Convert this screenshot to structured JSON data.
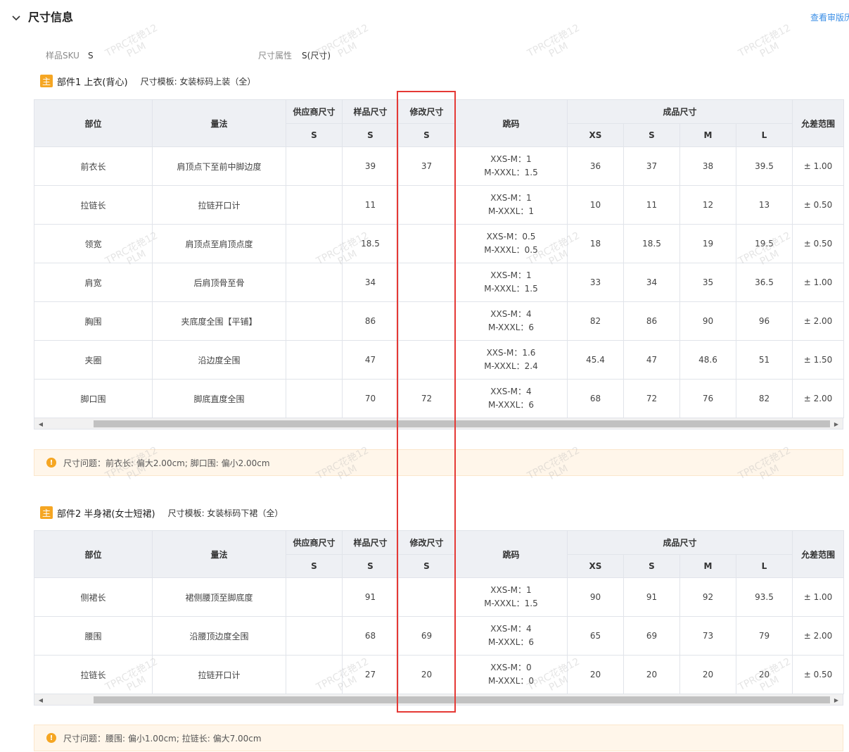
{
  "section": {
    "title": "尺寸信息",
    "review_link": "查看审版历"
  },
  "meta": {
    "sku_label": "样品SKU",
    "sku_value": "S",
    "attr_label": "尺寸属性",
    "attr_value": "S(尺寸)"
  },
  "headers": {
    "part": "部位",
    "method": "量法",
    "supplier": "供应商尺寸",
    "sample": "样品尺寸",
    "modify": "修改尺寸",
    "jump": "跳码",
    "finished": "成品尺寸",
    "tolerance": "允差范围",
    "size_s": "S",
    "sizes": [
      "XS",
      "S",
      "M",
      "L"
    ]
  },
  "parts": [
    {
      "badge": "主",
      "name": "部件1 上衣(背心)",
      "template": "尺寸模板: 女装标码上装（全）",
      "rows": [
        {
          "part": "前衣长",
          "method": "肩顶点下至前中脚边度",
          "supplier": "",
          "sample": "39",
          "modify": "37",
          "jump1": "XXS-M：1",
          "jump2": "M-XXXL：1.5",
          "xs": "36",
          "s": "37",
          "m": "38",
          "l": "39.5",
          "tol": "± 1.00"
        },
        {
          "part": "拉链长",
          "method": "拉链开口计",
          "supplier": "",
          "sample": "11",
          "modify": "",
          "jump1": "XXS-M：1",
          "jump2": "M-XXXL：1",
          "xs": "10",
          "s": "11",
          "m": "12",
          "l": "13",
          "tol": "± 0.50"
        },
        {
          "part": "领宽",
          "method": "肩顶点至肩顶点度",
          "supplier": "",
          "sample": "18.5",
          "modify": "",
          "jump1": "XXS-M：0.5",
          "jump2": "M-XXXL：0.5",
          "xs": "18",
          "s": "18.5",
          "m": "19",
          "l": "19.5",
          "tol": "± 0.50"
        },
        {
          "part": "肩宽",
          "method": "后肩顶骨至骨",
          "supplier": "",
          "sample": "34",
          "modify": "",
          "jump1": "XXS-M：1",
          "jump2": "M-XXXL：1.5",
          "xs": "33",
          "s": "34",
          "m": "35",
          "l": "36.5",
          "tol": "± 1.00"
        },
        {
          "part": "胸围",
          "method": "夹底度全围【平铺】",
          "supplier": "",
          "sample": "86",
          "modify": "",
          "jump1": "XXS-M：4",
          "jump2": "M-XXXL：6",
          "xs": "82",
          "s": "86",
          "m": "90",
          "l": "96",
          "tol": "± 2.00"
        },
        {
          "part": "夹圈",
          "method": "沿边度全围",
          "supplier": "",
          "sample": "47",
          "modify": "",
          "jump1": "XXS-M：1.6",
          "jump2": "M-XXXL：2.4",
          "xs": "45.4",
          "s": "47",
          "m": "48.6",
          "l": "51",
          "tol": "± 1.50"
        },
        {
          "part": "脚口围",
          "method": "脚底直度全围",
          "supplier": "",
          "sample": "70",
          "modify": "72",
          "jump1": "XXS-M：4",
          "jump2": "M-XXXL：6",
          "xs": "68",
          "s": "72",
          "m": "76",
          "l": "82",
          "tol": "± 2.00"
        }
      ],
      "issue": "尺寸问题：前衣长: 偏大2.00cm; 脚口围: 偏小2.00cm"
    },
    {
      "badge": "主",
      "name": "部件2 半身裙(女士短裙)",
      "template": "尺寸模板: 女装标码下裙（全）",
      "rows": [
        {
          "part": "侧裙长",
          "method": "裙侧腰顶至脚底度",
          "supplier": "",
          "sample": "91",
          "modify": "",
          "jump1": "XXS-M：1",
          "jump2": "M-XXXL：1.5",
          "xs": "90",
          "s": "91",
          "m": "92",
          "l": "93.5",
          "tol": "± 1.00"
        },
        {
          "part": "腰围",
          "method": "沿腰顶边度全围",
          "supplier": "",
          "sample": "68",
          "modify": "69",
          "jump1": "XXS-M：4",
          "jump2": "M-XXXL：6",
          "xs": "65",
          "s": "69",
          "m": "73",
          "l": "79",
          "tol": "± 2.00"
        },
        {
          "part": "拉链长",
          "method": "拉链开口计",
          "supplier": "",
          "sample": "27",
          "modify": "20",
          "jump1": "XXS-M：0",
          "jump2": "M-XXXL：0",
          "xs": "20",
          "s": "20",
          "m": "20",
          "l": "20",
          "tol": "± 0.50"
        }
      ],
      "issue": "尺寸问题：腰围: 偏小1.00cm; 拉链长: 偏大7.00cm"
    }
  ],
  "watermark": {
    "line1": "TPRC花艳12",
    "line2": "PLM"
  }
}
